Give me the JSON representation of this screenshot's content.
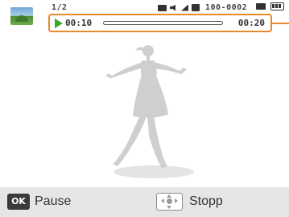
{
  "status": {
    "file_counter": "1/2",
    "file_number": "100-0002",
    "icons": [
      "movie-icon",
      "sound-icon",
      "signal-icon",
      "memory-card-icon",
      "internal-memory-icon",
      "battery-icon"
    ]
  },
  "playback": {
    "current_time": "00:10",
    "total_time": "00:20",
    "progress_fraction": 0.0,
    "highlight_color": "#e88a2c",
    "play_color": "#3aa62a"
  },
  "bottom_bar": {
    "ok_key": "OK",
    "ok_action": "Pause",
    "dpad_action": "Stopp"
  }
}
